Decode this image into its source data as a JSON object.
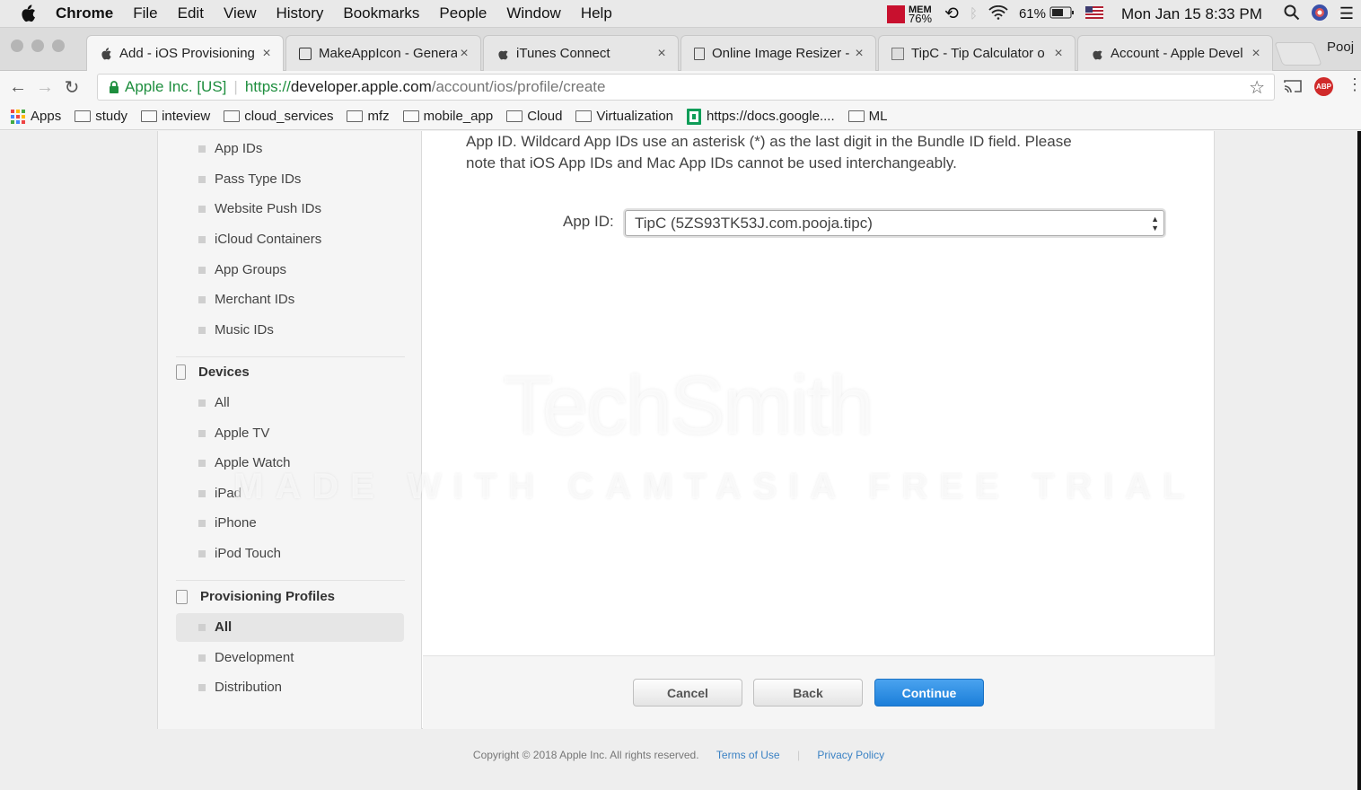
{
  "menubar": {
    "app": "Chrome",
    "items": [
      "File",
      "Edit",
      "View",
      "History",
      "Bookmarks",
      "People",
      "Window",
      "Help"
    ],
    "mem_label": "MEM",
    "mem_value": "76%",
    "battery": "61%",
    "datetime": "Mon Jan 15  8:33 PM"
  },
  "tabs": [
    {
      "label": "Add - iOS Provisioning"
    },
    {
      "label": "MakeAppIcon - Genera"
    },
    {
      "label": "iTunes Connect"
    },
    {
      "label": "Online Image Resizer -"
    },
    {
      "label": "TipC - Tip Calculator o"
    },
    {
      "label": "Account - Apple Devel"
    }
  ],
  "profile_tab": "Pooj",
  "address": {
    "secure_label": "Apple Inc. [US]",
    "scheme": "https://",
    "host": "developer.apple.com",
    "path": "/account/ios/profile/create"
  },
  "bookmarks": [
    "Apps",
    "study",
    "inteview",
    "cloud_services",
    "mfz",
    "mobile_app",
    "Cloud",
    "Virtualization",
    "https://docs.google....",
    "ML"
  ],
  "sidebar": {
    "identifiers": [
      "App IDs",
      "Pass Type IDs",
      "Website Push IDs",
      "iCloud Containers",
      "App Groups",
      "Merchant IDs",
      "Music IDs"
    ],
    "devices_heading": "Devices",
    "devices": [
      "All",
      "Apple TV",
      "Apple Watch",
      "iPad",
      "iPhone",
      "iPod Touch"
    ],
    "profiles_heading": "Provisioning Profiles",
    "profiles": [
      "All",
      "Development",
      "Distribution"
    ]
  },
  "main": {
    "desc_line1": "App ID. Wildcard App IDs use an asterisk (*) as the last digit in the Bundle ID field. Please",
    "desc_line2": "note that iOS App IDs and Mac App IDs cannot be used interchangeably.",
    "appid_label": "App ID:",
    "appid_value": "TipC (5ZS93TK53J.com.pooja.tipc)"
  },
  "buttons": {
    "cancel": "Cancel",
    "back": "Back",
    "continue": "Continue"
  },
  "footer": {
    "copyright": "Copyright © 2018 Apple Inc. All rights reserved.",
    "terms": "Terms of Use",
    "privacy": "Privacy Policy"
  },
  "watermark": {
    "brand": "TechSmith",
    "tagline": "MADE WITH CAMTASIA FREE TRIAL"
  },
  "colors": {
    "accent": "#1b7ed9",
    "secure": "#1e8e3e"
  }
}
